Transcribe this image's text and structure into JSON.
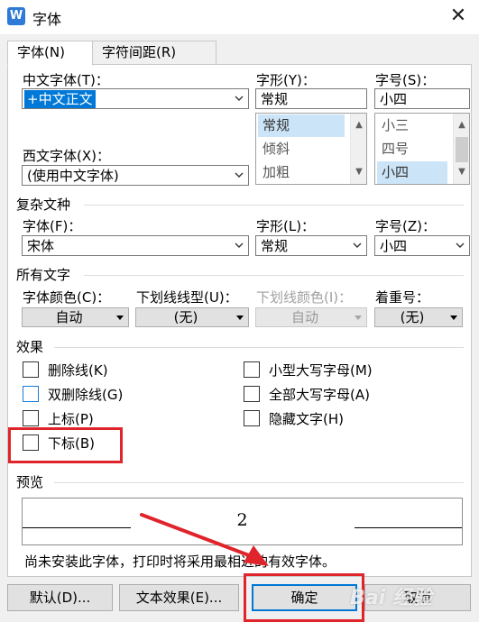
{
  "window": {
    "icon_text": "W",
    "title": "字体",
    "close": "✕"
  },
  "tabs": [
    "字体(N)",
    "字符间距(R)"
  ],
  "chinese_font": {
    "label": "中文字体(T)：",
    "value": "+中文正文"
  },
  "western_font": {
    "label": "西文字体(X)：",
    "value": "(使用中文字体)"
  },
  "style": {
    "label": "字形(Y)：",
    "value": "常规",
    "options": [
      "常规",
      "倾斜",
      "加粗"
    ],
    "selected_index": 0
  },
  "size": {
    "label": "字号(S)：",
    "value": "小四",
    "options": [
      "小三",
      "四号",
      "小四"
    ],
    "selected_index": 2
  },
  "complex": {
    "section": "复杂文种",
    "font_label": "字体(F)：",
    "font_value": "宋体",
    "style_label": "字形(L)：",
    "style_value": "常规",
    "size_label": "字号(Z)：",
    "size_value": "小四"
  },
  "all_text": {
    "section": "所有文字",
    "color_label": "字体颜色(C)：",
    "color_value": "自动",
    "underline_label": "下划线线型(U)：",
    "underline_value": "(无)",
    "underline_color_label": "下划线颜色(I)：",
    "underline_color_value": "自动",
    "emphasis_label": "着重号：",
    "emphasis_value": "(无)"
  },
  "effects": {
    "section": "效果",
    "strikethrough": "删除线(K)",
    "double_strikethrough": "双删除线(G)",
    "superscript": "上标(P)",
    "subscript": "下标(B)",
    "small_caps": "小型大写字母(M)",
    "all_caps": "全部大写字母(A)",
    "hidden": "隐藏文字(H)"
  },
  "preview": {
    "section": "预览",
    "sample": "2",
    "note": "尚未安装此字体，打印时将采用最相近的有效字体。"
  },
  "buttons": {
    "default": "默认(D)...",
    "text_effects": "文本效果(E)...",
    "ok": "确定",
    "cancel": "取消"
  },
  "watermark": "Bai 经验",
  "colors": {
    "accent": "#0078d7",
    "annotation_red": "#e0242b"
  }
}
